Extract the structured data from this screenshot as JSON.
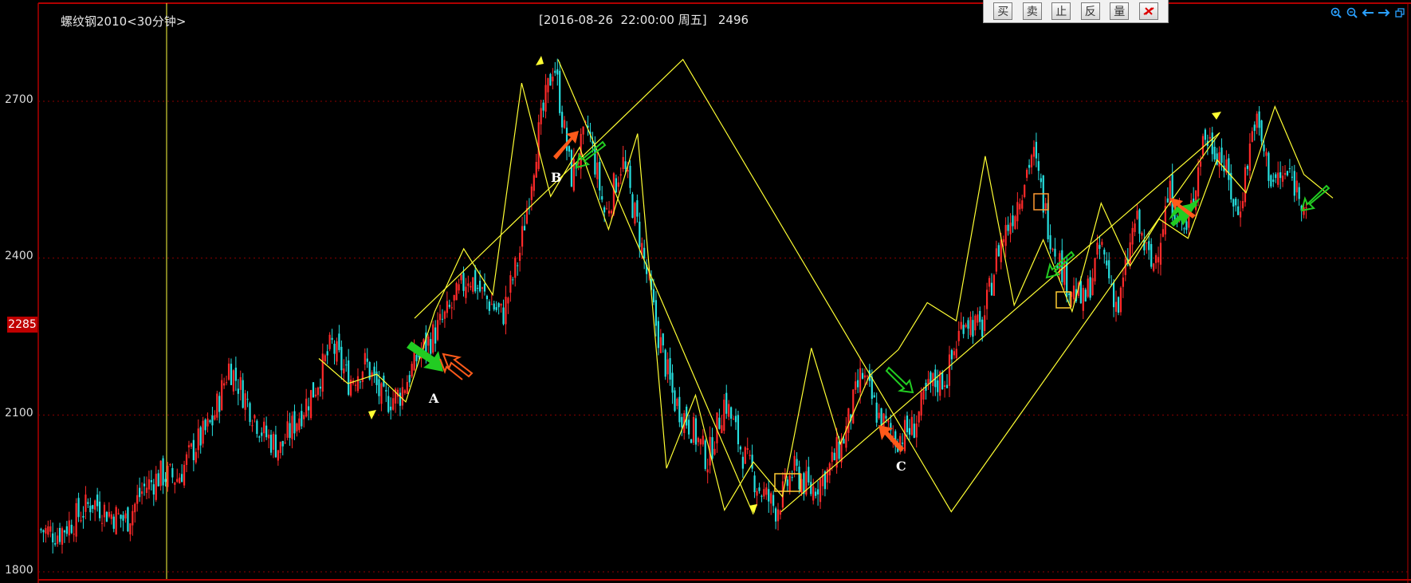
{
  "title": "螺纹钢2010<30分钟>",
  "cursor_info": "[2016-08-26  22:00:00 周五]   2496",
  "toolbar": {
    "buttons": [
      {
        "label": "买",
        "name": "buy-button"
      },
      {
        "label": "卖",
        "name": "sell-button"
      },
      {
        "label": "止",
        "name": "stop-button"
      },
      {
        "label": "反",
        "name": "reverse-button"
      },
      {
        "label": "量",
        "name": "volume-button"
      }
    ],
    "close_icon": "cancel-order-icon"
  },
  "right_icons": [
    "zoom-in-icon",
    "zoom-out-icon",
    "scroll-left-icon",
    "scroll-right-icon",
    "restore-window-icon"
  ],
  "price_labels": [
    "2700",
    "2400",
    "2100",
    "1800"
  ],
  "current_price": "2285",
  "point_labels": [
    "A",
    "B",
    "C"
  ],
  "colors": {
    "background": "#000000",
    "up_candle": "#ff2a2a",
    "down_candle": "#26e0e0",
    "trend_lines": "#ffff33",
    "buy_arrow": "#22cc22",
    "sell_arrow": "#ff5a1a",
    "grid": "#8b0000"
  },
  "chart_data": {
    "type": "candlestick",
    "title": "螺纹钢2010<30分钟>",
    "ylim": [
      1800,
      2800
    ],
    "y_ticks": [
      1800,
      2100,
      2400,
      2700
    ],
    "current_price": 2285,
    "cursor_value": 2496,
    "cursor_time": "2016-08-26 22:00:00",
    "price_path": [
      1880,
      1874,
      1902,
      1935,
      1912,
      1898,
      1960,
      1985,
      1980,
      2040,
      2085,
      2195,
      2130,
      2065,
      2035,
      2095,
      2150,
      2235,
      2165,
      2200,
      2125,
      2140,
      2210,
      2255,
      2305,
      2368,
      2323,
      2290,
      2410,
      2620,
      2778,
      2555,
      2650,
      2480,
      2588,
      2445,
      2268,
      2130,
      2078,
      2014,
      2130,
      2030,
      1960,
      1920,
      1995,
      1955,
      1990,
      2060,
      2180,
      2095,
      2055,
      2075,
      2155,
      2175,
      2290,
      2260,
      2420,
      2498,
      2605,
      2450,
      2355,
      2312,
      2425,
      2300,
      2475,
      2378,
      2525,
      2445,
      2635,
      2600,
      2478,
      2670,
      2545,
      2560,
      2505
    ],
    "zigzag_major": [
      2285,
      2780,
      1915,
      2640
    ],
    "zigzag_minor": [
      2208,
      2160,
      2178,
      2125,
      2298,
      2418,
      2330,
      2735,
      2518,
      2612,
      2455,
      2638,
      1998,
      2138,
      1918,
      2010,
      1944,
      2228,
      2045,
      2175,
      2225,
      2315,
      2280,
      2595,
      2310,
      2435,
      2298,
      2505,
      2385,
      2475,
      2438,
      2588,
      2525,
      2690,
      2560,
      2515
    ]
  }
}
